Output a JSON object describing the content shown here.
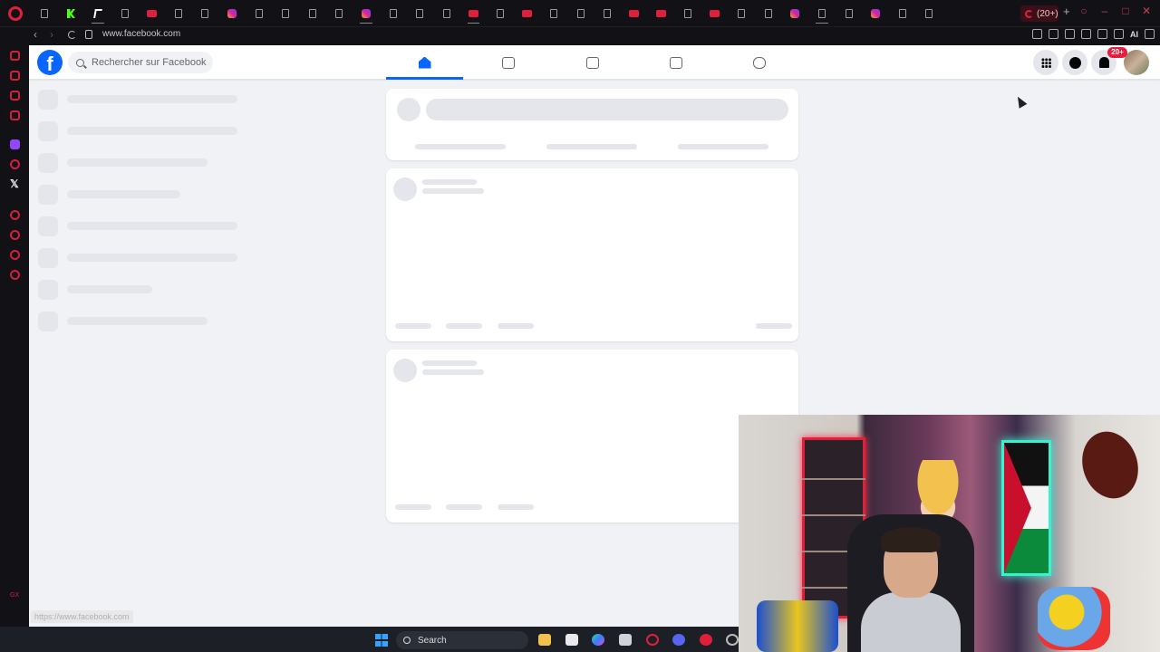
{
  "browser": {
    "tabs": [
      "page",
      "kk",
      "tk",
      "page",
      "yt",
      "page",
      "page",
      "ig",
      "page",
      "page",
      "page",
      "page",
      "ig",
      "page",
      "page",
      "page",
      "yt",
      "page",
      "yt",
      "page",
      "page",
      "page",
      "yt",
      "yt",
      "page",
      "yt",
      "page",
      "page",
      "ig",
      "page",
      "page",
      "ig",
      "page",
      "page"
    ],
    "active_tab_label": "(20+)",
    "url": "www.facebook.com",
    "ai_label": "AI",
    "accent_color": "#e0203a"
  },
  "facebook": {
    "logo": "f",
    "search_placeholder": "Rechercher sur Facebook",
    "nav_tabs": [
      {
        "name": "home",
        "icon": "home-icon",
        "active": true
      },
      {
        "name": "reels",
        "icon": "video-icon",
        "active": false
      },
      {
        "name": "dashboard",
        "icon": "chart-icon",
        "active": false
      },
      {
        "name": "marketplace",
        "icon": "store-icon",
        "active": false
      },
      {
        "name": "gaming",
        "icon": "gamepad-icon",
        "active": false
      }
    ],
    "notification_badge": "20+",
    "brand_color": "#0866ff"
  },
  "status_url": "https://www.facebook.com",
  "taskbar": {
    "search_label": "Search"
  }
}
